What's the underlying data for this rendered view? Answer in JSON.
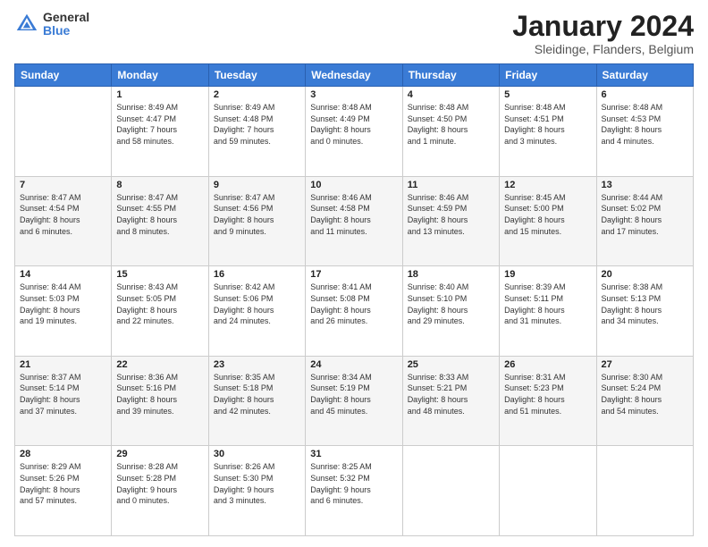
{
  "logo": {
    "general": "General",
    "blue": "Blue"
  },
  "header": {
    "month": "January 2024",
    "location": "Sleidinge, Flanders, Belgium"
  },
  "weekdays": [
    "Sunday",
    "Monday",
    "Tuesday",
    "Wednesday",
    "Thursday",
    "Friday",
    "Saturday"
  ],
  "weeks": [
    [
      {
        "day": "",
        "info": ""
      },
      {
        "day": "1",
        "info": "Sunrise: 8:49 AM\nSunset: 4:47 PM\nDaylight: 7 hours\nand 58 minutes."
      },
      {
        "day": "2",
        "info": "Sunrise: 8:49 AM\nSunset: 4:48 PM\nDaylight: 7 hours\nand 59 minutes."
      },
      {
        "day": "3",
        "info": "Sunrise: 8:48 AM\nSunset: 4:49 PM\nDaylight: 8 hours\nand 0 minutes."
      },
      {
        "day": "4",
        "info": "Sunrise: 8:48 AM\nSunset: 4:50 PM\nDaylight: 8 hours\nand 1 minute."
      },
      {
        "day": "5",
        "info": "Sunrise: 8:48 AM\nSunset: 4:51 PM\nDaylight: 8 hours\nand 3 minutes."
      },
      {
        "day": "6",
        "info": "Sunrise: 8:48 AM\nSunset: 4:53 PM\nDaylight: 8 hours\nand 4 minutes."
      }
    ],
    [
      {
        "day": "7",
        "info": "Sunrise: 8:47 AM\nSunset: 4:54 PM\nDaylight: 8 hours\nand 6 minutes."
      },
      {
        "day": "8",
        "info": "Sunrise: 8:47 AM\nSunset: 4:55 PM\nDaylight: 8 hours\nand 8 minutes."
      },
      {
        "day": "9",
        "info": "Sunrise: 8:47 AM\nSunset: 4:56 PM\nDaylight: 8 hours\nand 9 minutes."
      },
      {
        "day": "10",
        "info": "Sunrise: 8:46 AM\nSunset: 4:58 PM\nDaylight: 8 hours\nand 11 minutes."
      },
      {
        "day": "11",
        "info": "Sunrise: 8:46 AM\nSunset: 4:59 PM\nDaylight: 8 hours\nand 13 minutes."
      },
      {
        "day": "12",
        "info": "Sunrise: 8:45 AM\nSunset: 5:00 PM\nDaylight: 8 hours\nand 15 minutes."
      },
      {
        "day": "13",
        "info": "Sunrise: 8:44 AM\nSunset: 5:02 PM\nDaylight: 8 hours\nand 17 minutes."
      }
    ],
    [
      {
        "day": "14",
        "info": "Sunrise: 8:44 AM\nSunset: 5:03 PM\nDaylight: 8 hours\nand 19 minutes."
      },
      {
        "day": "15",
        "info": "Sunrise: 8:43 AM\nSunset: 5:05 PM\nDaylight: 8 hours\nand 22 minutes."
      },
      {
        "day": "16",
        "info": "Sunrise: 8:42 AM\nSunset: 5:06 PM\nDaylight: 8 hours\nand 24 minutes."
      },
      {
        "day": "17",
        "info": "Sunrise: 8:41 AM\nSunset: 5:08 PM\nDaylight: 8 hours\nand 26 minutes."
      },
      {
        "day": "18",
        "info": "Sunrise: 8:40 AM\nSunset: 5:10 PM\nDaylight: 8 hours\nand 29 minutes."
      },
      {
        "day": "19",
        "info": "Sunrise: 8:39 AM\nSunset: 5:11 PM\nDaylight: 8 hours\nand 31 minutes."
      },
      {
        "day": "20",
        "info": "Sunrise: 8:38 AM\nSunset: 5:13 PM\nDaylight: 8 hours\nand 34 minutes."
      }
    ],
    [
      {
        "day": "21",
        "info": "Sunrise: 8:37 AM\nSunset: 5:14 PM\nDaylight: 8 hours\nand 37 minutes."
      },
      {
        "day": "22",
        "info": "Sunrise: 8:36 AM\nSunset: 5:16 PM\nDaylight: 8 hours\nand 39 minutes."
      },
      {
        "day": "23",
        "info": "Sunrise: 8:35 AM\nSunset: 5:18 PM\nDaylight: 8 hours\nand 42 minutes."
      },
      {
        "day": "24",
        "info": "Sunrise: 8:34 AM\nSunset: 5:19 PM\nDaylight: 8 hours\nand 45 minutes."
      },
      {
        "day": "25",
        "info": "Sunrise: 8:33 AM\nSunset: 5:21 PM\nDaylight: 8 hours\nand 48 minutes."
      },
      {
        "day": "26",
        "info": "Sunrise: 8:31 AM\nSunset: 5:23 PM\nDaylight: 8 hours\nand 51 minutes."
      },
      {
        "day": "27",
        "info": "Sunrise: 8:30 AM\nSunset: 5:24 PM\nDaylight: 8 hours\nand 54 minutes."
      }
    ],
    [
      {
        "day": "28",
        "info": "Sunrise: 8:29 AM\nSunset: 5:26 PM\nDaylight: 8 hours\nand 57 minutes."
      },
      {
        "day": "29",
        "info": "Sunrise: 8:28 AM\nSunset: 5:28 PM\nDaylight: 9 hours\nand 0 minutes."
      },
      {
        "day": "30",
        "info": "Sunrise: 8:26 AM\nSunset: 5:30 PM\nDaylight: 9 hours\nand 3 minutes."
      },
      {
        "day": "31",
        "info": "Sunrise: 8:25 AM\nSunset: 5:32 PM\nDaylight: 9 hours\nand 6 minutes."
      },
      {
        "day": "",
        "info": ""
      },
      {
        "day": "",
        "info": ""
      },
      {
        "day": "",
        "info": ""
      }
    ]
  ]
}
